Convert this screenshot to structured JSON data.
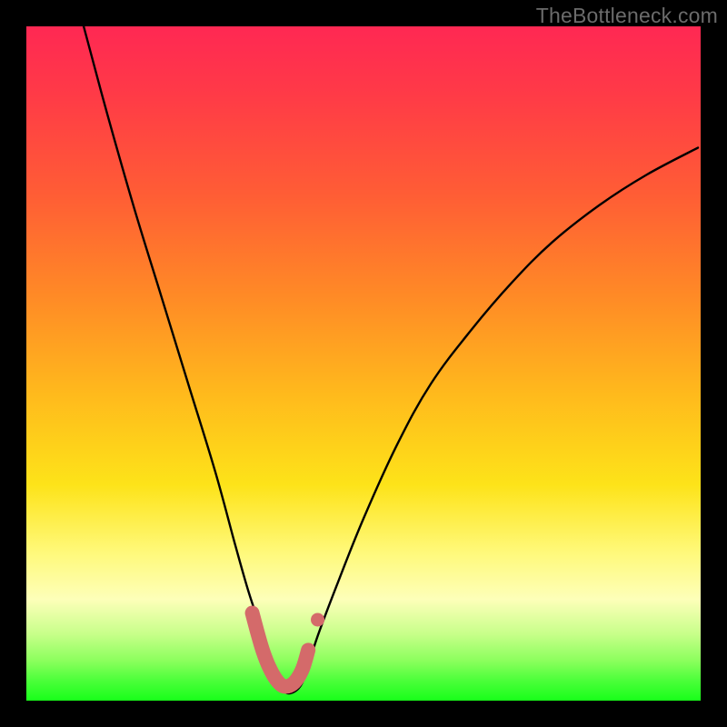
{
  "watermark": "TheBottleneck.com",
  "colors": {
    "page_bg": "#000000",
    "curve_stroke": "#000000",
    "marker_stroke": "#d46a6a",
    "marker_fill": "#d46a6a",
    "watermark_text": "#6b6b6b"
  },
  "chart_data": {
    "type": "line",
    "title": "",
    "xlabel": "",
    "ylabel": "",
    "xlim": [
      0,
      100
    ],
    "ylim": [
      0,
      100
    ],
    "grid": false,
    "legend": false,
    "note": "Axes unlabeled; values are percent of plot box width/height. y=0 at bottom (green), y=100 at top (red). Curve shows a V-shaped bottleneck dip with minimum near x≈38, y≈0.",
    "series": [
      {
        "name": "bottleneck-curve",
        "x": [
          8.5,
          12,
          16,
          20,
          24,
          28,
          31,
          33,
          35,
          36.5,
          38,
          40,
          41.5,
          43,
          46,
          50,
          55,
          60,
          66,
          72,
          78,
          85,
          92,
          99.6
        ],
        "y": [
          100,
          87,
          73,
          60,
          47,
          34,
          23,
          16,
          10,
          5,
          1.5,
          1.5,
          4,
          9,
          17,
          27,
          38,
          47,
          55,
          62,
          68,
          73.5,
          78,
          82
        ]
      }
    ],
    "markers": {
      "name": "highlight-band",
      "note": "thick salmon segment near curve minimum plus one detached dot",
      "points_x": [
        33.5,
        34.3,
        35.1,
        36.0,
        37.0,
        38.0,
        39.0,
        40.0,
        41.0,
        41.8
      ],
      "points_y": [
        13.0,
        10.0,
        7.3,
        5.0,
        3.2,
        2.2,
        2.2,
        3.0,
        4.8,
        7.5
      ],
      "dot": {
        "x": 43.2,
        "y": 12.0
      }
    }
  }
}
